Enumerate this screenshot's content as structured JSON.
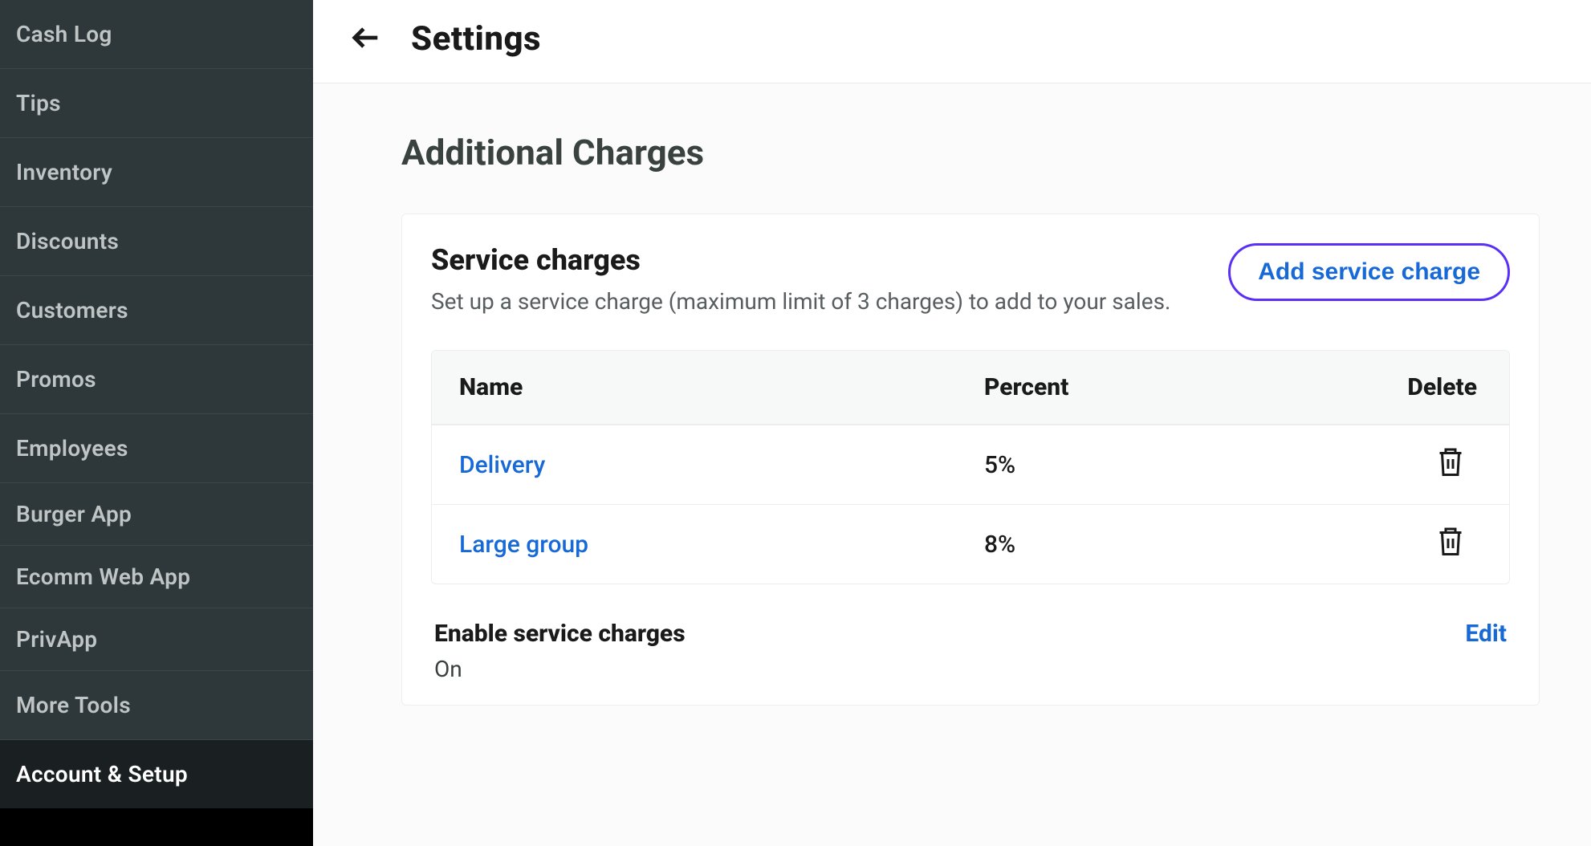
{
  "sidebar": {
    "items": [
      {
        "label": "Cash Log",
        "active": false
      },
      {
        "label": "Tips",
        "active": false
      },
      {
        "label": "Inventory",
        "active": false
      },
      {
        "label": "Discounts",
        "active": false
      },
      {
        "label": "Customers",
        "active": false
      },
      {
        "label": "Promos",
        "active": false
      },
      {
        "label": "Employees",
        "active": false
      },
      {
        "label": "Burger App",
        "active": false
      },
      {
        "label": "Ecomm Web App",
        "active": false
      },
      {
        "label": "PrivApp",
        "active": false
      },
      {
        "label": "More Tools",
        "active": false
      },
      {
        "label": "Account & Setup",
        "active": true
      }
    ]
  },
  "header": {
    "title": "Settings"
  },
  "page": {
    "title": "Additional Charges"
  },
  "service_charges": {
    "heading": "Service charges",
    "description": "Set up a service charge (maximum limit of 3 charges) to add to your sales.",
    "add_button_label": "Add service charge",
    "columns": {
      "name": "Name",
      "percent": "Percent",
      "delete": "Delete"
    },
    "rows": [
      {
        "name": "Delivery",
        "percent": "5%"
      },
      {
        "name": "Large group",
        "percent": "8%"
      }
    ],
    "enable": {
      "label": "Enable service charges",
      "status": "On",
      "edit_label": "Edit"
    }
  }
}
